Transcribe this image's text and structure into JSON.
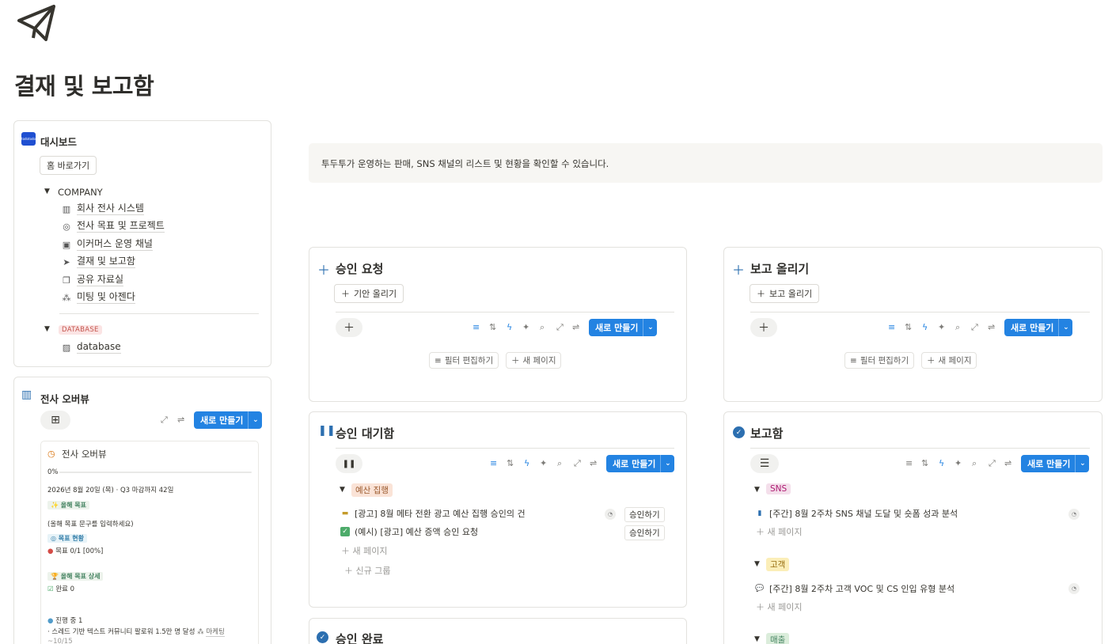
{
  "page": {
    "icon": "paper-plane-icon",
    "title": "결재 및 보고함"
  },
  "sidebar_card": {
    "header": "대시보드",
    "logo_text": "todotodo",
    "home_button": "홈 바로가기",
    "company_label": "COMPANY",
    "links": [
      {
        "icon": "building-icon",
        "label": "회사 전사 시스템"
      },
      {
        "icon": "target-icon",
        "label": "전사 목표 및 프로젝트"
      },
      {
        "icon": "storefront-icon",
        "label": "이커머스 운영 채널"
      },
      {
        "icon": "paper-plane-icon",
        "label": "결재 및 보고함"
      },
      {
        "icon": "copy-icon",
        "label": "공유 자료실"
      },
      {
        "icon": "people-icon",
        "label": "미팅 및 아젠다"
      }
    ],
    "database_tag": "DATABASE",
    "database_link": "database"
  },
  "overview_card": {
    "header": "전사 오버뷰",
    "new_button": "새로 만들기",
    "inner_title": "전사 오버뷰",
    "progress": "0%",
    "progress_value": 0,
    "date_line": "2026년 8월 20일 (목) · Q3 마감까지 42일",
    "tag_goal": "올해 목표",
    "goal_placeholder": "(올해 목표 문구를 입력하세요)",
    "tag_status": "목표 현황",
    "goal_status": "목표 0/1 [00%]",
    "tag_detail": "올해 목표 상세",
    "done_line": "완료 0",
    "inprogress_line": "진행 중 1",
    "item_line": "스레드 기반 텍스트 커뮤니티 팔로워 1.5만 명 달성",
    "item_tag": "마케팅",
    "date_small": "~10/15"
  },
  "callout": {
    "text": "투두투가 운영하는 판매, SNS 채널의 리스트 및 현황을 확인할 수 있습니다."
  },
  "sections": {
    "approval_request": {
      "title": "승인 요청",
      "add_button": "기안 올리기",
      "new_button": "새로 만들기",
      "filter_edit": "필터 편집하기",
      "new_page": "새 페이지"
    },
    "report_upload": {
      "title": "보고 올리기",
      "add_button": "보고 올리기",
      "new_button": "새로 만들기",
      "filter_edit": "필터 편집하기",
      "new_page": "새 페이지"
    },
    "approval_waiting": {
      "title": "승인 대기함",
      "new_button": "새로 만들기",
      "group": "예산 집행",
      "rows": [
        {
          "icon": "card-icon",
          "text": "[광고] 8월 메타 전환 광고 예산 집행 승인의 건",
          "action": "승인하기"
        },
        {
          "icon": "check-icon",
          "text": "(예시) [광고] 예산 증액 승인 요청",
          "action": "승인하기"
        }
      ],
      "new_page": "새 페이지",
      "new_group": "신규 그룹"
    },
    "approval_done": {
      "title": "승인 완료"
    },
    "report_box": {
      "title": "보고함",
      "new_button": "새로 만들기",
      "groups": [
        {
          "tag": "SNS",
          "row": "[주간] 8월 2주차 SNS 채널 도달 및 숏폼 성과 분석",
          "new_page": "새 페이지"
        },
        {
          "tag": "고객",
          "row": "[주간] 8월 2주차 고객 VOC 및 CS 인입 유형 분석",
          "new_page": "새 페이지"
        },
        {
          "tag": "매출"
        }
      ]
    }
  },
  "colors": {
    "accent": "#2383e2",
    "section_icon": "#2c6fb0",
    "callout_bg": "#f7f6f3"
  }
}
